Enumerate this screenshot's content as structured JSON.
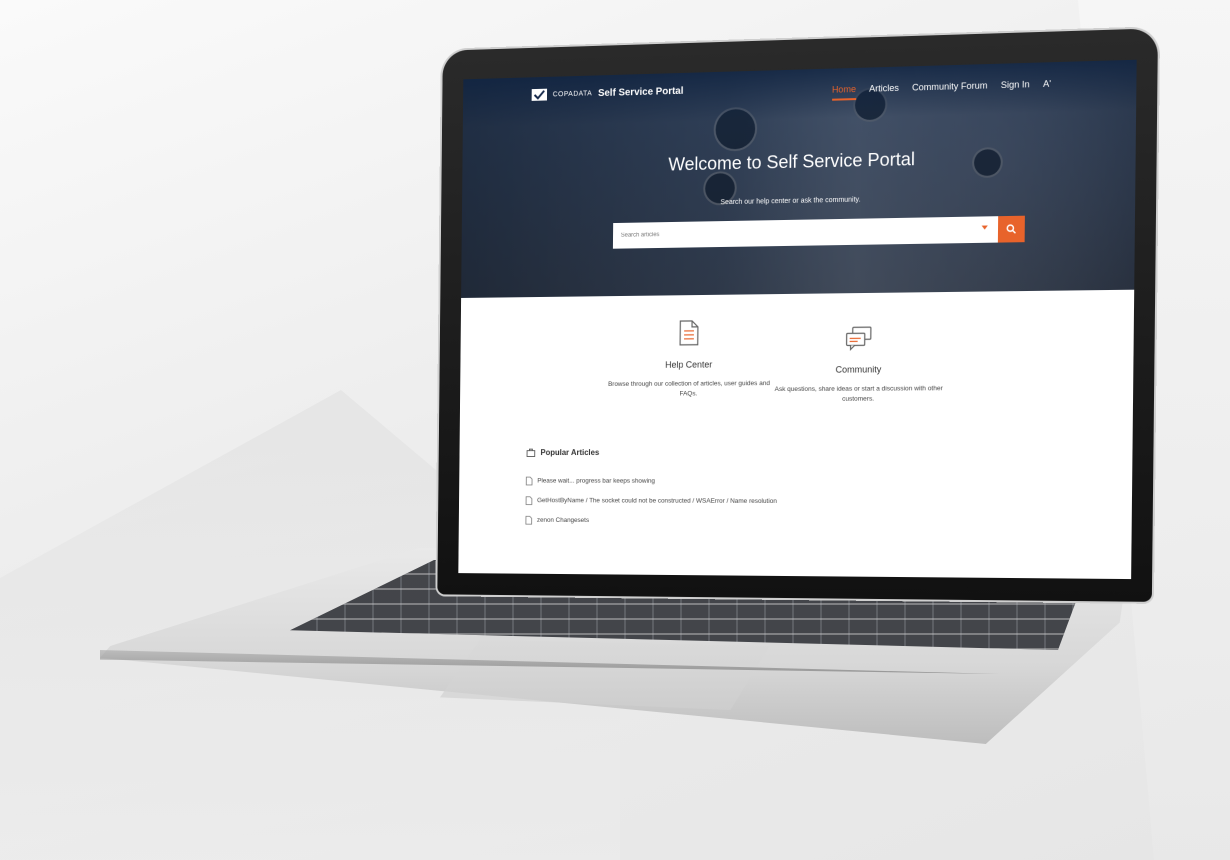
{
  "site": {
    "company": "COPADATA",
    "title": "Self Service Portal"
  },
  "nav": {
    "items": [
      {
        "label": "Home",
        "active": true
      },
      {
        "label": "Articles",
        "active": false
      },
      {
        "label": "Community Forum",
        "active": false
      },
      {
        "label": "Sign In",
        "active": false
      }
    ],
    "font_size_label": "A'"
  },
  "hero": {
    "title": "Welcome to Self Service Portal",
    "subtitle": "Search our help center or ask the community.",
    "search_placeholder": "Search articles"
  },
  "cards": {
    "help_center": {
      "title": "Help Center",
      "description": "Browse through our collection of articles, user guides and FAQs."
    },
    "community": {
      "title": "Community",
      "description": "Ask questions, share ideas or start a discussion with other customers."
    }
  },
  "popular": {
    "heading": "Popular Articles",
    "items": [
      "Please wait... progress bar keeps showing",
      "GetHostByName / The socket could not be constructed / WSAError / Name resolution",
      "zenon Changesets"
    ]
  },
  "colors": {
    "accent": "#e8632b",
    "nav_background": "#14284a"
  }
}
